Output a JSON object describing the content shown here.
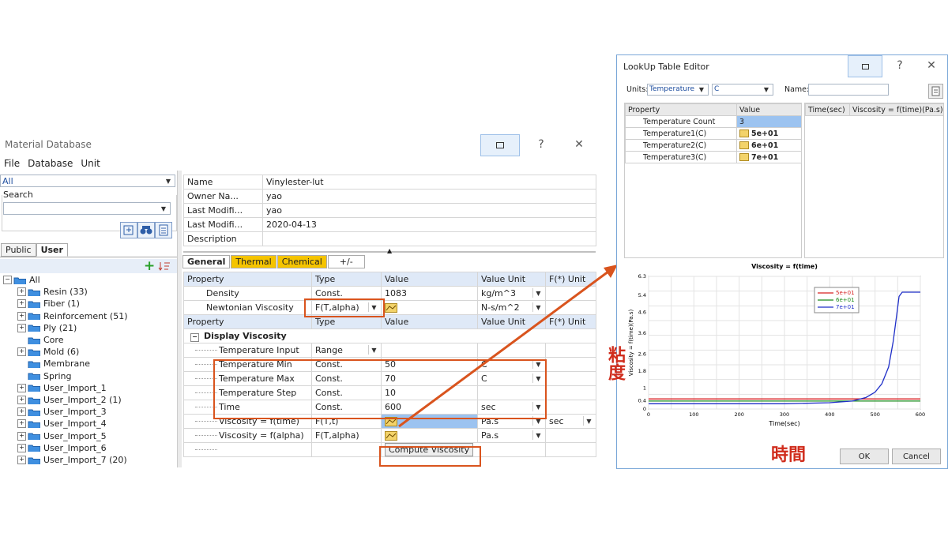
{
  "material_window": {
    "title": "Material Database",
    "help_label": "?",
    "close_label": "✕",
    "menu": [
      "File",
      "Database",
      "Unit"
    ],
    "filter_value": "All",
    "search_label": "Search",
    "tabs": [
      "Public",
      "User"
    ],
    "tree": [
      {
        "label": "All",
        "expander": "−",
        "level": 0
      },
      {
        "label": "Resin (33)",
        "expander": "+",
        "level": 1
      },
      {
        "label": "Fiber (1)",
        "expander": "+",
        "level": 1
      },
      {
        "label": "Reinforcement (51)",
        "expander": "+",
        "level": 1
      },
      {
        "label": "Ply (21)",
        "expander": "+",
        "level": 1
      },
      {
        "label": "Core",
        "expander": "",
        "level": 1
      },
      {
        "label": "Mold (6)",
        "expander": "+",
        "level": 1
      },
      {
        "label": "Membrane",
        "expander": "",
        "level": 1
      },
      {
        "label": "Spring",
        "expander": "",
        "level": 1
      },
      {
        "label": "User_Import_1",
        "expander": "+",
        "level": 1
      },
      {
        "label": "User_Import_2 (1)",
        "expander": "+",
        "level": 1
      },
      {
        "label": "User_Import_3",
        "expander": "+",
        "level": 1
      },
      {
        "label": "User_Import_4",
        "expander": "+",
        "level": 1
      },
      {
        "label": "User_Import_5",
        "expander": "+",
        "level": 1
      },
      {
        "label": "User_Import_6",
        "expander": "+",
        "level": 1
      },
      {
        "label": "User_Import_7 (20)",
        "expander": "+",
        "level": 1
      }
    ],
    "info": [
      {
        "key": "Name",
        "value": "Vinylester-lut"
      },
      {
        "key": "Owner Na...",
        "value": "yao"
      },
      {
        "key": "Last Modifi...",
        "value": "yao"
      },
      {
        "key": "Last Modifi...",
        "value": "2020-04-13"
      },
      {
        "key": "Description",
        "value": ""
      }
    ],
    "prop_tabs": [
      "General",
      "Thermal",
      "Chemical",
      "+/-"
    ],
    "headers": [
      "Property",
      "Type",
      "Value",
      "Value Unit",
      "F(*) Unit"
    ],
    "rows_top": [
      {
        "property": "Density",
        "type": "Const.",
        "value": "1083",
        "unit": "kg/m^3",
        "funit": ""
      },
      {
        "property": "Newtonian Viscosity",
        "type": "F(T,alpha)",
        "value": "",
        "unit": "N-s/m^2",
        "funit": ""
      }
    ],
    "section_title": "Display Viscosity",
    "rows_bottom": [
      {
        "property": "Temperature Input",
        "type": "Range",
        "value": "",
        "unit": "",
        "funit": ""
      },
      {
        "property": "Temperature Min",
        "type": "Const.",
        "value": "50",
        "unit": "C",
        "funit": ""
      },
      {
        "property": "Temperature Max",
        "type": "Const.",
        "value": "70",
        "unit": "C",
        "funit": ""
      },
      {
        "property": "Temperature Step",
        "type": "Const.",
        "value": "10",
        "unit": "",
        "funit": ""
      },
      {
        "property": "Time",
        "type": "Const.",
        "value": "600",
        "unit": "sec",
        "funit": ""
      },
      {
        "property": "Viscosity = f(time)",
        "type": "F(T,t)",
        "value": "",
        "unit": "Pa.s",
        "funit": "sec"
      },
      {
        "property": "Viscosity = f(alpha)",
        "type": "F(T,alpha)",
        "value": "",
        "unit": "Pa.s",
        "funit": ""
      }
    ],
    "compute_button": "Compute Viscosity"
  },
  "lookup_window": {
    "title": "LookUp Table Editor",
    "help_label": "?",
    "close_label": "✕",
    "units_label": "Units:",
    "units_value": "Temperature",
    "unit_value": "C",
    "name_label": "Name:",
    "name_value": "",
    "table_headers": [
      "Property",
      "Value"
    ],
    "table_rows": [
      {
        "property": "Temperature Count",
        "value": "3"
      },
      {
        "property": "Temperature1(C)",
        "value": "5e+01"
      },
      {
        "property": "Temperature2(C)",
        "value": "6e+01"
      },
      {
        "property": "Temperature3(C)",
        "value": "7e+01"
      }
    ],
    "right_headers": [
      "Time(sec)",
      "Viscosity = f(time)(Pa.s)"
    ],
    "ok_label": "OK",
    "cancel_label": "Cancel"
  },
  "annotations": {
    "viscosity_jp": "粘度",
    "time_jp": "時間",
    "accent_color": "#d9541e"
  },
  "chart_data": {
    "type": "line",
    "title": "Viscosity = f(time)",
    "xlabel": "Time(sec)",
    "ylabel": "Viscosity = f(time)(Pa.s)",
    "xlim": [
      0,
      600
    ],
    "ylim": [
      0,
      6.3
    ],
    "xticks": [
      0,
      100,
      200,
      300,
      400,
      500,
      600
    ],
    "yticks": [
      0,
      0.4,
      1,
      1.8,
      2.6,
      3.6,
      4.6,
      5.4,
      6.3
    ],
    "ytick_labels": [
      "0",
      "0.4",
      "1",
      "1.8",
      "2.6",
      "3.6",
      "4.6",
      "5.4",
      "6.3"
    ],
    "legend_position": "top-left",
    "grid": true,
    "series": [
      {
        "name": "5e+01",
        "color": "#d62020",
        "points": [
          [
            0,
            0.48
          ],
          [
            600,
            0.48
          ]
        ]
      },
      {
        "name": "6e+01",
        "color": "#1a8a1a",
        "points": [
          [
            0,
            0.38
          ],
          [
            600,
            0.38
          ]
        ]
      },
      {
        "name": "7e+01",
        "color": "#1f2fc8",
        "points": [
          [
            0,
            0.25
          ],
          [
            300,
            0.25
          ],
          [
            400,
            0.3
          ],
          [
            450,
            0.38
          ],
          [
            480,
            0.55
          ],
          [
            500,
            0.8
          ],
          [
            515,
            1.2
          ],
          [
            530,
            2.0
          ],
          [
            540,
            3.2
          ],
          [
            548,
            4.5
          ],
          [
            553,
            5.35
          ],
          [
            560,
            5.55
          ],
          [
            600,
            5.55
          ]
        ]
      }
    ]
  }
}
